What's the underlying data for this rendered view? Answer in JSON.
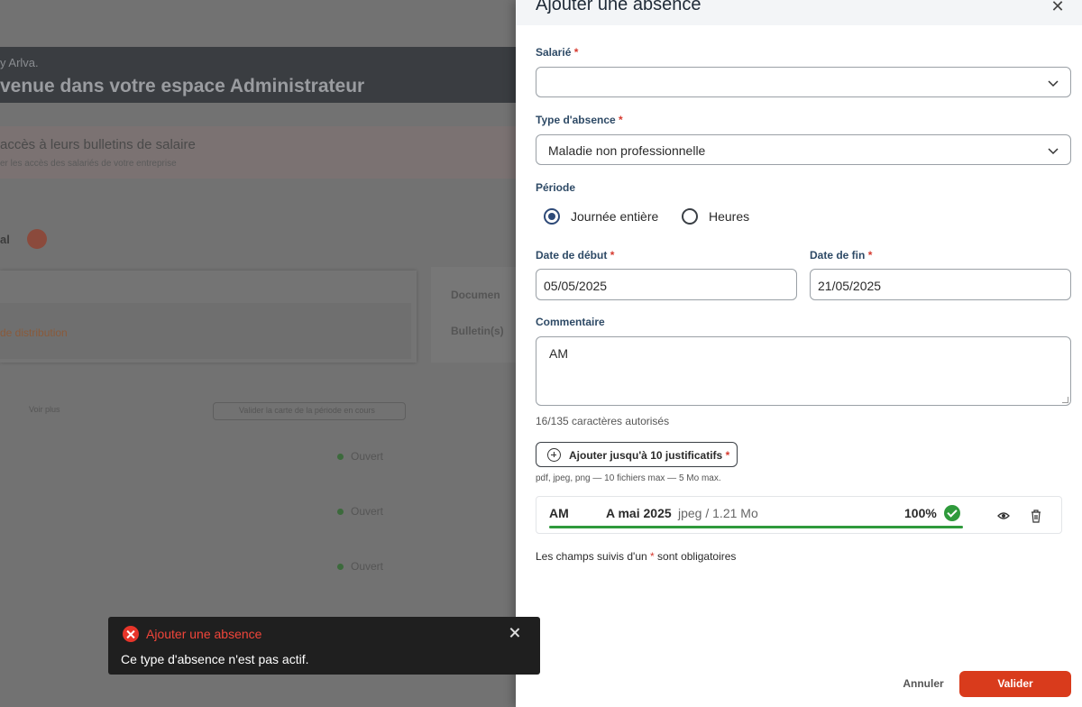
{
  "background": {
    "header_sub": "y Arlva.",
    "header_title": "venue dans votre espace Administrateur",
    "alert_line1": "accès à leurs bulletins de salaire",
    "alert_line2": "er les accès des salariés de votre entreprise",
    "tab_label": "al",
    "card_link": "de distribution",
    "card_right_title": "Documen",
    "card_right_item": "Bulletin(s)",
    "small_text": "Voir plus",
    "btn_label": "Valider la carte de la période en cours",
    "status_items": [
      "Ouvert",
      "Ouvert",
      "Ouvert"
    ]
  },
  "drawer": {
    "title": "Ajouter une absence",
    "employee": {
      "label": "Salarié",
      "required": "*",
      "value": ""
    },
    "absence_type": {
      "label": "Type d'absence",
      "required": "*",
      "value": "Maladie non professionnelle"
    },
    "period": {
      "label": "Période",
      "options": [
        {
          "label": "Journée entière",
          "selected": true
        },
        {
          "label": "Heures",
          "selected": false
        }
      ]
    },
    "start_date": {
      "label": "Date de début",
      "required": "*",
      "value": "05/05/2025"
    },
    "end_date": {
      "label": "Date de fin",
      "required": "*",
      "value": "21/05/2025"
    },
    "comment": {
      "label": "Commentaire",
      "value": "AM",
      "helper": "16/135 caractères autorisés"
    },
    "upload": {
      "button_label": "Ajouter jusqu'à 10 justificatifs",
      "required": "*",
      "hint": "pdf, jpeg, png — 10 fichiers max — 5 Mo max."
    },
    "file": {
      "name": "AM",
      "date": "A mai 2025",
      "meta": "jpeg / 1.21 Mo",
      "progress_label": "100%",
      "progress": 1.0
    },
    "mandatory_note_prefix": "Les champs suivis d'un",
    "mandatory_note_star": "*",
    "mandatory_note_suffix": "sont obligatoires",
    "cancel_label": "Annuler",
    "validate_label": "Valider"
  },
  "toast": {
    "title": "Ajouter une absence",
    "message": "Ce type d'absence n'est pas actif."
  },
  "colors": {
    "accent_red": "#d93b1c",
    "label_blue": "#2e4a66",
    "radio_blue": "#2e4a78",
    "success_green": "#2f9a3c",
    "toast_bg": "#1f1f1f",
    "toast_error": "#f0453a"
  },
  "icons": {
    "close": "close-icon",
    "chevron": "chevron-down-icon",
    "plus": "plus-circle-icon",
    "check": "check-circle-icon",
    "eye": "eye-icon",
    "trash": "trash-icon",
    "error": "error-circle-icon"
  }
}
